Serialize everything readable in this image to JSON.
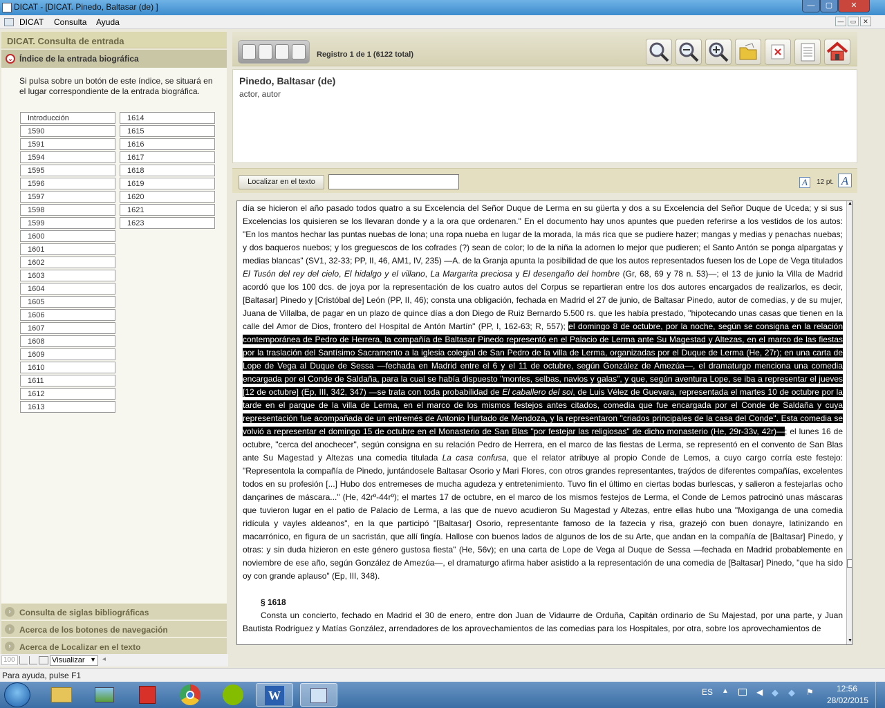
{
  "window": {
    "title": "DICAT - [DICAT. Pinedo, Baltasar (de) ]",
    "min": "—",
    "max": "▢",
    "close": "✕"
  },
  "menu": {
    "app": "DICAT",
    "items": [
      "Consulta",
      "Ayuda"
    ],
    "mdi": [
      "—",
      "▭",
      "✕"
    ]
  },
  "left": {
    "header": "DICAT. Consulta de entrada",
    "section": "Índice de la entrada biográfica",
    "description": "Si pulsa sobre un botón de este índice, se situará en el lugar correspondiente de la entrada biográfica.",
    "col1": [
      "Introducción",
      "1590",
      "1591",
      "1594",
      "1595",
      "1596",
      "1597",
      "1598",
      "1599",
      "1600",
      "1601",
      "1602",
      "1603",
      "1604",
      "1605",
      "1606",
      "1607",
      "1608",
      "1609",
      "1610",
      "1611",
      "1612",
      "1613"
    ],
    "col2": [
      "1614",
      "1615",
      "1616",
      "1617",
      "1618",
      "1619",
      "1620",
      "1621",
      "1623"
    ],
    "accordions": [
      "Consulta de siglas bibliográficas",
      "Acerca de los botones de navegación",
      "Acerca de Localizar en el texto"
    ],
    "view_bar": {
      "zoom": "100",
      "select": "Visualizar"
    }
  },
  "toolbar": {
    "record": "Registro 1 de 1  (6122 total)",
    "buttons": [
      "magnifier-icon",
      "zoom-out-icon",
      "zoom-in-icon",
      "folder-icon",
      "close-doc-icon",
      "document-icon",
      "home-icon"
    ]
  },
  "entry": {
    "name": "Pinedo, Baltasar (de)",
    "role": "actor, autor"
  },
  "search": {
    "button": "Localizar en el texto",
    "value": "",
    "font_size": "12 pt."
  },
  "text": {
    "p1_before": "día se hicieron el año pasado todos quatro a su Excelencia del Señor Duque de Lerma en su güerta y dos a su Excelencia del Señor Duque de Uceda; y si sus Excelencias los quisieren se los llevaran donde y a la ora que ordenaren.\" En el documento hay unos apuntes que pueden referirse a los vestidos de los autos: \"En los mantos hechar las puntas nuebas de lona; una ropa nueba en lugar de la morada, la más rica que se pudiere hazer; mangas y medias y penachas nuebas; y dos baqueros nuebos; y los greguescos de los cofrades (?) sean de color; lo de la niña la adornen lo mejor que pudieren; el Santo Antón se ponga alpargatas y medias blancas\" (SV1, 32-33; PP, II, 46, AM1, IV, 235) —A. de la Granja apunta la posibilidad de que los autos representados fuesen los de Lope de Vega titulados ",
    "t1": "El Tusón del rey del cielo",
    "t1s": ", ",
    "t2": "El hidalgo y el villano",
    "t2s": ", ",
    "t3": "La Margarita preciosa",
    "t3s": " y ",
    "t4": "El desengaño del hombre",
    "p1_mid": " (Gr, 68, 69 y 78 n. 53)—; el 13 de junio la Villa de Madrid acordó que los 100 dcs. de joya por la representación de los cuatro autos del Corpus se repartieran entre los dos autores encargados de realizarlos, es decir, [Baltasar] Pinedo y [Cristóbal de] León (PP, II, 46); consta una obligación, fechada en Madrid el 27 de junio, de Baltasar Pinedo, autor de comedias, y de su mujer, Juana de Villalba, de pagar en un plazo de quince días a don Diego de Ruiz Bernardo 5.500 rs. que les había prestado, \"hipotecando unas casas que tienen en la calle del Amor de Dios, frontero del Hospital de Antón Martín\" (PP, I, 162-63; R, 557); ",
    "hl1": "el domingo 8 de octubre, por la noche, según se consigna en la relación contemporánea de Pedro de Herrera, la compañía de Baltasar Pinedo representó en el Palacio de Lerma ante Su Magestad y Altezas, en el marco de las fiestas por la traslación del Santísimo Sacramento a la iglesia colegial de San Pedro de la villa de Lerma, organizadas por el Duque de Lerma (He, 27r); en una carta de Lope de Vega al Duque de Sessa —fechada en Madrid entre el 6 y el 11 de octubre, según González de Amezúa—, el dramaturgo menciona una comedia encargada por el Conde de Saldaña, para la cual se había dispuesto \"montes, selbas, navios y galas\", y que, según aventura Lope, se iba a representar el jueves [12 de octubre] (Ep, III, 342, 347) —se trata con toda probabilidad de ",
    "hl_title": "El caballero del sol",
    "hl2": ", de Luis Vélez de Guevara, representada el martes 10 de octubre por la tarde en el parque de la villa de Lerma, en el marco de los mismos festejos antes citados, comedia que fue encargada por el Conde de Saldaña y cuya representación fue acompañada de un entremés de Antonio Hurtado de Mendoza, y la representaron \"criados principales de la casa del Conde\". Esta comedia se volvió a representar el domingo 15 de octubre en el Monasterio de San Blas \"por festejar las religiosas\" de dicho monasterio (He, 29r-33v, 42r)—",
    "p1_after": "; el lunes 16 de octubre, \"cerca del anochecer\", según consigna en su relación Pedro de Herrera, en el marco de las fiestas de Lerma, se representó en el convento de San Blas ante Su Magestad y Altezas una comedia titulada ",
    "t5": "La casa confusa",
    "p1_end": ", que el relator atribuye al propio Conde de Lemos, a cuyo cargo corría este festejo: \"Representola la compañía de Pinedo, juntándosele Baltasar Osorio y Mari Flores, con otros grandes representantes, traýdos de diferentes compañías, excelentes todos en su profesión [...] Hubo dos entremeses de mucha agudeza y entretenimiento. Tuvo fin el último en ciertas bodas burlescas, y salieron a festejarlas ocho dançarines de máscara...\" (He, 42rº-44rº); el martes 17 de octubre, en el marco de los mismos festejos de Lerma, el Conde de Lemos patrocinó unas máscaras que tuvieron lugar en el patio de Palacio de Lerma, a las que de nuevo acudieron Su Magestad y Altezas, entre ellas hubo una \"Moxiganga de una comedia ridícula y vayles aldeanos\", en la que participó \"[Baltasar] Osorio, representante famoso de la fazecia y risa, grazejó con buen donayre, latinizando en macarrónico, en figura de un sacristán, que allí fingía. Hallose con buenos lados de algunos de los de su Arte, que andan en la compañía de [Baltasar] Pinedo, y otras: y sin duda hizieron en este género gustosa fiesta\" (He, 56v); en una carta de Lope de Vega al Duque de Sessa —fechada en Madrid probablemente en noviembre de ese año, según González de Amezúa—, el dramaturgo afirma haber asistido a la representación de una comedia de [Baltasar] Pinedo, \"que ha sido oy con grande aplauso\" (Ep, III, 348).",
    "heading": "§ 1618",
    "p2": "Consta un concierto, fechado en Madrid el 30 de enero, entre don Juan de Vidaurre de Orduña, Capitán ordinario de Su Majestad, por una parte, y Juan Bautista Rodríguez y Matías González, arrendadores de los aprovechamientos de las comedias para los Hospitales, por otra, sobre los aprovechamientos de"
  },
  "status": "Para ayuda, pulse F1",
  "taskbar": {
    "lang": "ES",
    "time": "12:56",
    "date": "28/02/2015"
  }
}
